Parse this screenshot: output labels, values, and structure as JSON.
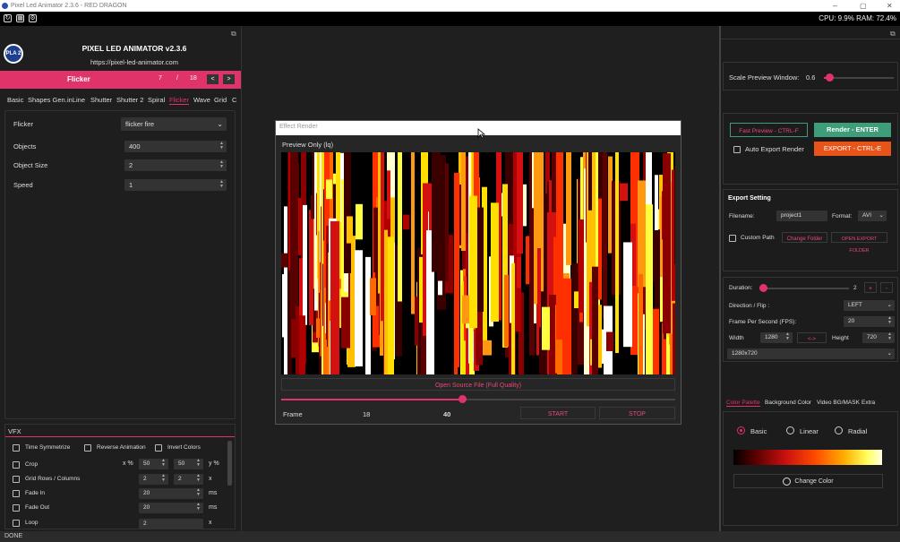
{
  "window": {
    "title": "Pixel Led Animator 2.3.6 - RED DRAGON"
  },
  "sysinfo": "CPU: 9.9% RAM: 72.4%",
  "status": "DONE",
  "app": {
    "name": "PIXEL LED ANIMATOR v2.3.6",
    "url": "https://pixel-led-animator.com",
    "logo_text": "PLA 2"
  },
  "effect_bar": {
    "name": "Flicker",
    "current": "7",
    "sep": "/",
    "total": "18",
    "prev": "<",
    "next": ">"
  },
  "tabs": [
    "Basic",
    "Shapes Gen.",
    "inLine",
    "Shutter",
    "Shutter 2",
    "Spiral",
    "Flicker",
    "Wave",
    "Grid",
    "C"
  ],
  "params": {
    "flicker_label": "Flicker",
    "flicker_value": "flicker fire",
    "objects_label": "Objects",
    "objects_value": "400",
    "size_label": "Object Size",
    "size_value": "2",
    "speed_label": "Speed",
    "speed_value": "1"
  },
  "vfx": {
    "title": "VFX",
    "time_symmetrize": "Time Symmetrize",
    "reverse": "Reverse Animation",
    "invert": "Invert Colors",
    "crop": "Crop",
    "crop_x_unit": "x %",
    "crop_x": "50",
    "crop_y": "50",
    "crop_y_unit": "y %",
    "grid": "Grid Rows / Columns",
    "grid_rows": "2",
    "grid_cols": "2",
    "grid_unit": "x",
    "fadein": "Fade In",
    "fadein_value": "20",
    "fadein_unit": "ms",
    "fadeout": "Fade Out",
    "fadeout_value": "20",
    "fadeout_unit": "ms",
    "loop": "Loop",
    "loop_value": "2",
    "loop_unit": "x"
  },
  "render": {
    "title": "Effect Render",
    "preview_label": "Preview Only (lq)",
    "open_source": "Open Source File (Full Quality)",
    "frame_label": "Frame",
    "frame_current": "18",
    "frame_total": "40",
    "progress": 0.46,
    "start": "START",
    "stop": "STOP"
  },
  "right": {
    "scale_label": "Scale Preview Window:",
    "scale_value": "0.6",
    "fast_preview": "Fast Preview - CTRL-F",
    "render_btn": "Render - ENTER",
    "auto_export": "Auto Export Render",
    "export_btn": "EXPORT - CTRL-E",
    "export_title": "Export Setting",
    "filename_label": "Filename:",
    "filename_value": "project1",
    "format_label": "Format:",
    "format_value": "AVI",
    "custom_path": "Custom Path",
    "change_folder": "Change Folder",
    "open_export": "OPEN EXPORT FOLDER",
    "duration_label": "Duration:",
    "duration_value": "2",
    "plus": "+",
    "minus": "-",
    "direction_label": "Direction / Flip :",
    "direction_value": "LEFT",
    "fps_label": "Frame Per Second (FPS):",
    "fps_value": "20",
    "width_label": "Width",
    "width_value": "1280",
    "link": "<->",
    "height_label": "Height",
    "height_value": "720",
    "resolution": "1280x720",
    "color_tabs": [
      "Color Palette",
      "Background Color",
      "Video BG/MASK",
      "Extra"
    ],
    "basic": "Basic",
    "linear": "Linear",
    "radial": "Radial",
    "change_color": "Change Color"
  },
  "colors": {
    "accent": "#e0336a",
    "green": "#3e9e7a",
    "orange": "#e8531a"
  }
}
